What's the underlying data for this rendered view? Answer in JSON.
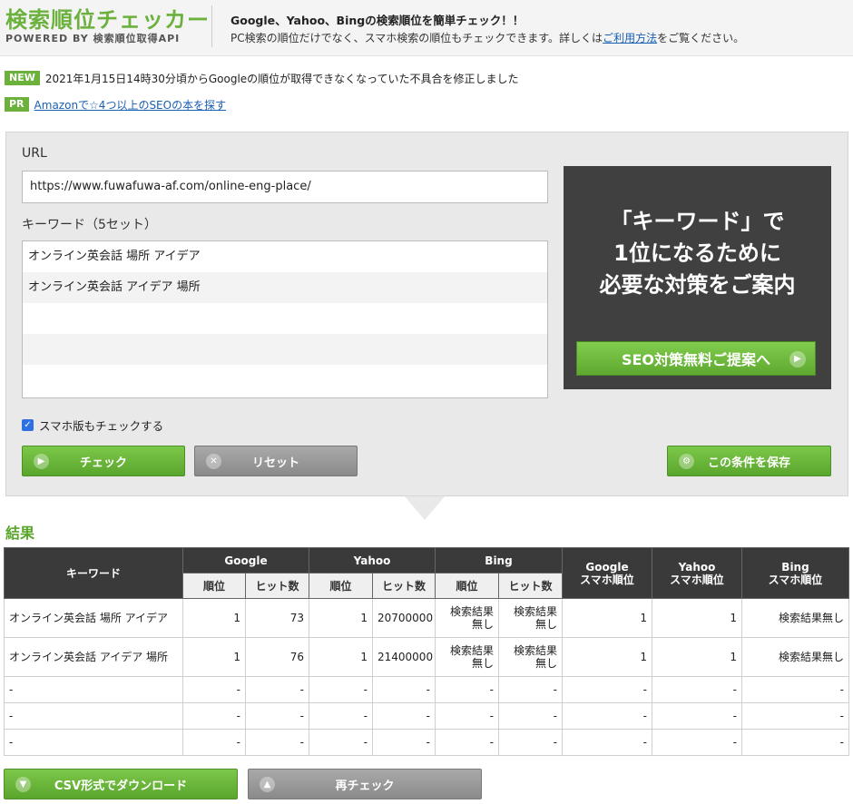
{
  "header": {
    "title": "検索順位チェッカー",
    "subtitle": "POWERED BY 検索順位取得API",
    "tagline_1": "Google、Yahoo、Bingの検索順位を簡単チェック！！",
    "tagline_2_prefix": "PC検索の順位だけでなく、スマホ検索の順位もチェックできます。詳しくは",
    "tagline_2_link": "ご利用方法",
    "tagline_2_suffix": "をご覧ください。"
  },
  "notices": [
    {
      "tag": "NEW",
      "text": "2021年1月15日14時30分頃からGoogleの順位が取得できなくなっていた不具合を修正しました"
    },
    {
      "tag": "PR",
      "text": "Amazonで☆4つ以上のSEOの本を探す"
    }
  ],
  "form": {
    "url_label": "URL",
    "url_value": "https://www.fuwafuwa-af.com/online-eng-place/",
    "keyword_label": "キーワード（5セット）",
    "keywords": [
      "オンライン英会話 場所 アイデア",
      "オンライン英会話 アイデア 場所",
      "",
      "",
      ""
    ],
    "mobile_check_label": "スマホ版もチェックする",
    "mobile_checked": true,
    "check_button": "チェック",
    "reset_button": "リセット",
    "save_button": "この条件を保存"
  },
  "ad": {
    "line_1": "「キーワード」で",
    "line_2": "1位になるために",
    "line_3": "必要な対策をご案内",
    "button": "SEO対策無料ご提案へ"
  },
  "results": {
    "title": "結果",
    "headers": {
      "keyword": "キーワード",
      "google": "Google",
      "yahoo": "Yahoo",
      "bing": "Bing",
      "rank": "順位",
      "hits": "ヒット数",
      "google_mobile_1": "Google",
      "google_mobile_2": "スマホ順位",
      "yahoo_mobile_1": "Yahoo",
      "yahoo_mobile_2": "スマホ順位",
      "bing_mobile_1": "Bing",
      "bing_mobile_2": "スマホ順位"
    },
    "rows": [
      {
        "keyword": "オンライン英会話 場所 アイデア",
        "g_rank": "1",
        "g_hits": "73",
        "y_rank": "1",
        "y_hits": "20700000",
        "b_rank": "検索結果無し",
        "b_hits": "検索結果無し",
        "gm": "1",
        "ym": "1",
        "bm": "検索結果無し"
      },
      {
        "keyword": "オンライン英会話 アイデア 場所",
        "g_rank": "1",
        "g_hits": "76",
        "y_rank": "1",
        "y_hits": "21400000",
        "b_rank": "検索結果無し",
        "b_hits": "検索結果無し",
        "gm": "1",
        "ym": "1",
        "bm": "検索結果無し"
      },
      {
        "keyword": "-",
        "g_rank": "-",
        "g_hits": "-",
        "y_rank": "-",
        "y_hits": "-",
        "b_rank": "-",
        "b_hits": "-",
        "gm": "-",
        "ym": "-",
        "bm": "-"
      },
      {
        "keyword": "-",
        "g_rank": "-",
        "g_hits": "-",
        "y_rank": "-",
        "y_hits": "-",
        "b_rank": "-",
        "b_hits": "-",
        "gm": "-",
        "ym": "-",
        "bm": "-"
      },
      {
        "keyword": "-",
        "g_rank": "-",
        "g_hits": "-",
        "y_rank": "-",
        "y_hits": "-",
        "b_rank": "-",
        "b_hits": "-",
        "gm": "-",
        "ym": "-",
        "bm": "-"
      }
    ],
    "csv_button": "CSV形式でダウンロード",
    "recheck_button": "再チェック"
  }
}
